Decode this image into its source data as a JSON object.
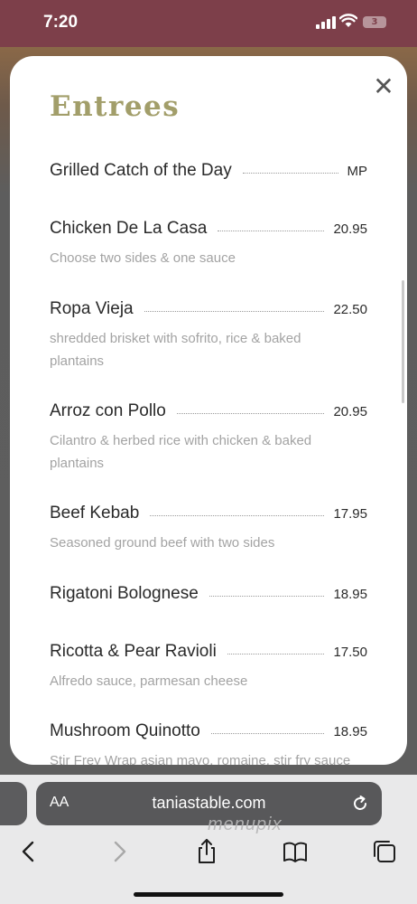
{
  "status_bar": {
    "time": "7:20",
    "battery_level": "3"
  },
  "menu": {
    "title": "Entrees",
    "close_icon": "close-icon",
    "items": [
      {
        "name": "Grilled Catch of the Day",
        "price": "MP",
        "description": ""
      },
      {
        "name": "Chicken De La Casa",
        "price": "20.95",
        "description": "Choose two sides & one sauce"
      },
      {
        "name": "Ropa Vieja",
        "price": "22.50",
        "description": "shredded brisket with sofrito, rice & baked plantains"
      },
      {
        "name": "Arroz con Pollo",
        "price": "20.95",
        "description": "Cilantro & herbed rice with chicken & baked plantains"
      },
      {
        "name": "Beef Kebab",
        "price": "17.95",
        "description": "Seasoned ground beef with two sides"
      },
      {
        "name": "Rigatoni Bolognese",
        "price": "18.95",
        "description": ""
      },
      {
        "name": "Ricotta & Pear Ravioli",
        "price": "17.50",
        "description": "Alfredo sauce, parmesan cheese"
      },
      {
        "name": "Mushroom Quinotto",
        "price": "18.95",
        "description": "Stir Frey Wrap asian mayo, romaine, stir fry sauce"
      }
    ]
  },
  "browser": {
    "text_size_label": "AA",
    "url": "taniastable.com",
    "watermark": "menupix",
    "icons": [
      "back-icon",
      "forward-icon",
      "share-icon",
      "bookmarks-icon",
      "tabs-icon",
      "reload-icon"
    ]
  },
  "colors": {
    "status_bar_bg": "#7d3f4a",
    "title_color": "#a29e6a",
    "description_color": "#a3a3a3"
  }
}
